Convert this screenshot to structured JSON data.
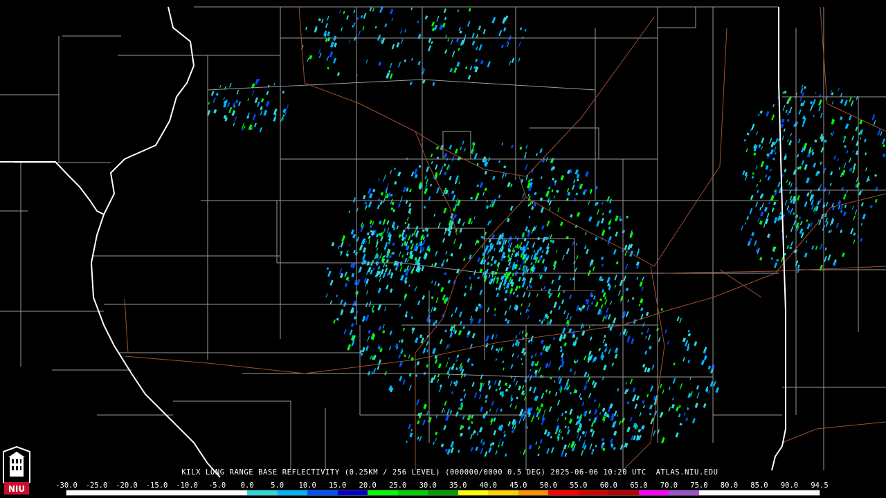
{
  "caption": "KILX LONG RANGE BASE REFLECTIVITY (0.25KM / 256 LEVEL) (000000/0000 0.5 DEG) 2025-06-06 10:20 UTC  ATLAS.NIU.EDU",
  "colorbar": {
    "ticks": [
      "-30.0",
      "-25.0",
      "-20.0",
      "-15.0",
      "-10.0",
      "-5.0",
      "0.0",
      "5.0",
      "10.0",
      "15.0",
      "20.0",
      "25.0",
      "30.0",
      "35.0",
      "40.0",
      "45.0",
      "50.0",
      "55.0",
      "60.0",
      "65.0",
      "70.0",
      "75.0",
      "80.0",
      "85.0",
      "90.0",
      "94.5"
    ],
    "colors": [
      "#ffffff",
      "#ffffff",
      "#ffffff",
      "#ffffff",
      "#ffffff",
      "#ffffff",
      "#2fd8d8",
      "#00b4ff",
      "#0050ff",
      "#0000cc",
      "#00ff00",
      "#00d200",
      "#00a000",
      "#ffff00",
      "#ffd000",
      "#ff9000",
      "#ff0000",
      "#d40000",
      "#b40000",
      "#ff00ff",
      "#9a55c8",
      "#ffffff",
      "#ffffff",
      "#ffffff",
      "#ffffff"
    ]
  },
  "logo": {
    "text": "NIU",
    "color": "#c8102e"
  }
}
